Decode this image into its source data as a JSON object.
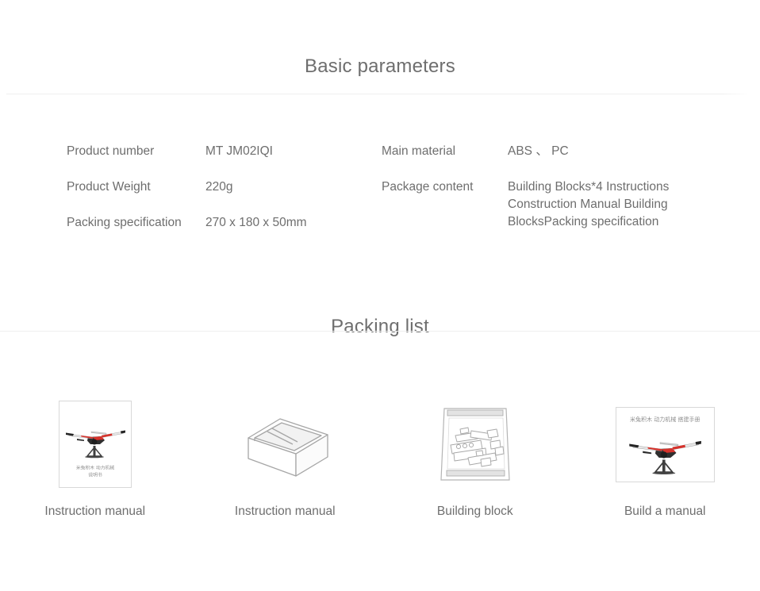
{
  "sections": {
    "basic_parameters": {
      "title": "Basic parameters",
      "rows_left": [
        {
          "label": "Product number",
          "value": "MT JM02IQI"
        },
        {
          "label": "Product Weight",
          "value": "220g"
        },
        {
          "label": "Packing specification",
          "value": "270 x 180 x 50mm"
        }
      ],
      "rows_right": [
        {
          "label": "Main material",
          "value": "ABS 、 PC"
        },
        {
          "label": "Package content",
          "value": "Building Blocks*4  Instructions\nConstruction Manual  Building\nBlocksPacking specification"
        }
      ]
    },
    "packing_list": {
      "title": "Packing list",
      "items": [
        {
          "caption": "Instruction manual",
          "thumbnail": "manual-cover-portrait-icon",
          "cover_text_line1": "米兔积木 动力机械",
          "cover_text_line2": "说明书"
        },
        {
          "caption": "Instruction manual",
          "thumbnail": "open-box-tray-icon"
        },
        {
          "caption": "Building block",
          "thumbnail": "zip-bag-of-blocks-icon"
        },
        {
          "caption": "Build a manual",
          "thumbnail": "build-manual-cover-landscape-icon",
          "cover_text_line1": "米兔积木 动力机械 搭建手册"
        }
      ]
    }
  },
  "colors": {
    "background": "#ffffff",
    "text": "#6e6e6e",
    "divider": "#efefef",
    "card_border": "#d8d8d8",
    "model_accent_red": "#d7322b",
    "model_dark": "#3a3a3a",
    "line_art": "#9a9a9a"
  }
}
